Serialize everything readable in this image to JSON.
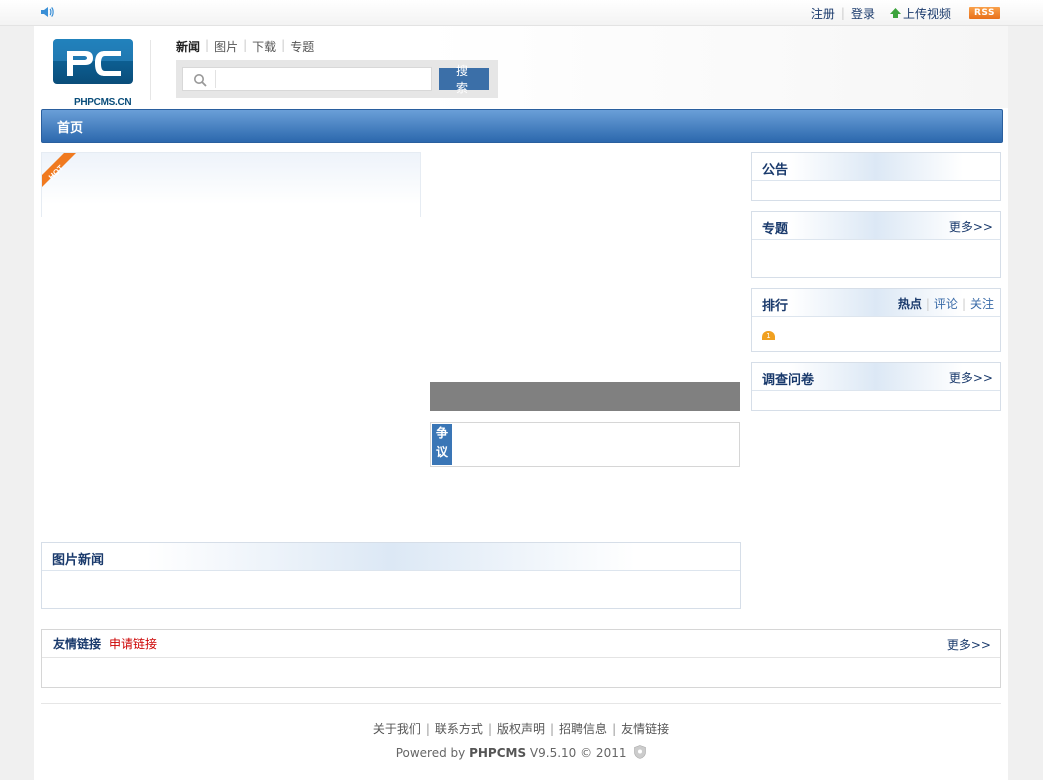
{
  "topbar": {
    "register": "注册",
    "login": "登录",
    "upload_video": "上传视频",
    "rss": "RSS"
  },
  "logo": {
    "text": "PHPCMS.CN",
    "letters": "PC"
  },
  "category_nav": [
    "新闻",
    "图片",
    "下载",
    "专题"
  ],
  "search": {
    "placeholder": "",
    "button": "搜 索"
  },
  "navbar": {
    "home": "首页"
  },
  "hot_badge": "HOT",
  "dispute_tag": "争议",
  "sidebar": {
    "notice": {
      "title": "公告"
    },
    "topics": {
      "title": "专题",
      "more": "更多>>"
    },
    "ranking": {
      "title": "排行",
      "tabs": [
        "热点",
        "评论",
        "关注"
      ],
      "first_rank": "1"
    },
    "survey": {
      "title": "调查问卷",
      "more": "更多>>"
    }
  },
  "picture_news": {
    "title": "图片新闻"
  },
  "friend_links": {
    "title": "友情链接",
    "apply": "申请链接",
    "more": "更多>>"
  },
  "footer": {
    "links": [
      "关于我们",
      "联系方式",
      "版权声明",
      "招聘信息",
      "友情链接"
    ],
    "powered_prefix": "Powered by ",
    "powered_brand": "PHPCMS",
    "powered_suffix": " V9.5.10 © 2011"
  },
  "colors": {
    "accent_blue": "#2c68ad",
    "link_red": "#cc0000",
    "rss_orange": "#e8701a"
  }
}
